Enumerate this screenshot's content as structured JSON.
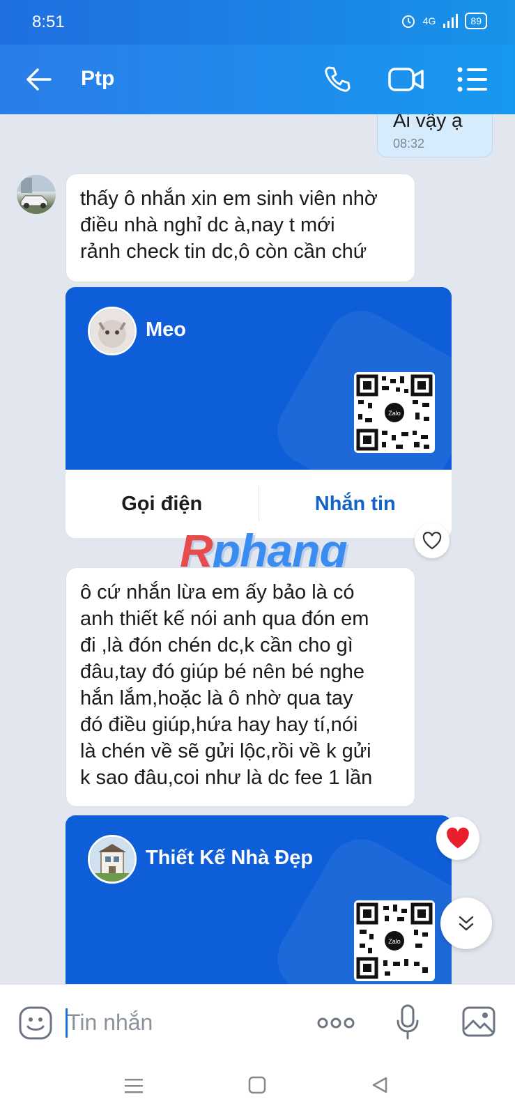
{
  "status_bar": {
    "time": "8:51",
    "network": "4G",
    "battery": "89"
  },
  "header": {
    "title": "Ptp"
  },
  "messages": {
    "outgoing_partial": {
      "text": "Ai vậy ạ",
      "time": "08:32"
    },
    "incoming_1": {
      "lines": [
        "thấy ô nhắn xin em sinh viên nhờ",
        "điều nhà nghỉ dc à,nay t mới",
        "rảnh check tin dc,ô còn cần chứ"
      ]
    },
    "contact_card_1": {
      "name": "Meo",
      "qr_badge": "Zalo",
      "call_label": "Gọi điện",
      "message_label": "Nhắn tin"
    },
    "incoming_2": {
      "lines": [
        "ô cứ nhắn lừa em ấy bảo là có",
        "anh thiết kế nói anh qua đón em",
        "đi ,là đón chén dc,k cần cho gì",
        "đâu,tay đó giúp bé nên bé nghe",
        "hắn lắm,hoặc là ô nhờ qua tay",
        "đó điều giúp,hứa hay hay tí,nói",
        "là chén về sẽ gửi lộc,rồi về k gửi",
        "k sao đâu,coi như là dc fee 1 lần"
      ]
    },
    "contact_card_2": {
      "name": "Thiết Kế Nhà Đẹp",
      "qr_badge": "Zalo"
    }
  },
  "watermark": {
    "first": "R",
    "rest": "phang"
  },
  "input": {
    "placeholder": "Tin nhắn"
  },
  "colors": {
    "brand_blue": "#1a82e6",
    "card_blue": "#0d5ed8",
    "heart_red": "#e8202c"
  }
}
